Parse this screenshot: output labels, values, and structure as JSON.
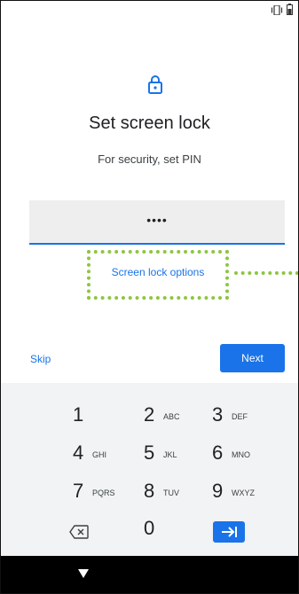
{
  "header": {
    "title": "Set screen lock",
    "subtitle": "For security, set PIN"
  },
  "pin_field": {
    "masked_value": "••••"
  },
  "links": {
    "screen_lock_options": "Screen lock options"
  },
  "actions": {
    "skip_label": "Skip",
    "next_label": "Next"
  },
  "keypad": {
    "keys": [
      {
        "digit": "1",
        "letters": ""
      },
      {
        "digit": "2",
        "letters": "ABC"
      },
      {
        "digit": "3",
        "letters": "DEF"
      },
      {
        "digit": "4",
        "letters": "GHI"
      },
      {
        "digit": "5",
        "letters": "JKL"
      },
      {
        "digit": "6",
        "letters": "MNO"
      },
      {
        "digit": "7",
        "letters": "PQRS"
      },
      {
        "digit": "8",
        "letters": "TUV"
      },
      {
        "digit": "9",
        "letters": "WXYZ"
      }
    ],
    "zero": "0"
  },
  "icons": {
    "lock": "lock-icon",
    "vibrate": "vibrate-icon",
    "battery": "battery-icon",
    "delete": "backspace-icon",
    "tab": "tab-arrow-icon",
    "back": "back-triangle-icon"
  },
  "colors": {
    "accent": "#1a73e8",
    "highlight": "#8dc63f",
    "field_bg": "#eeeeee",
    "keypad_bg": "#f1f3f4",
    "nav_bar": "#000000"
  }
}
